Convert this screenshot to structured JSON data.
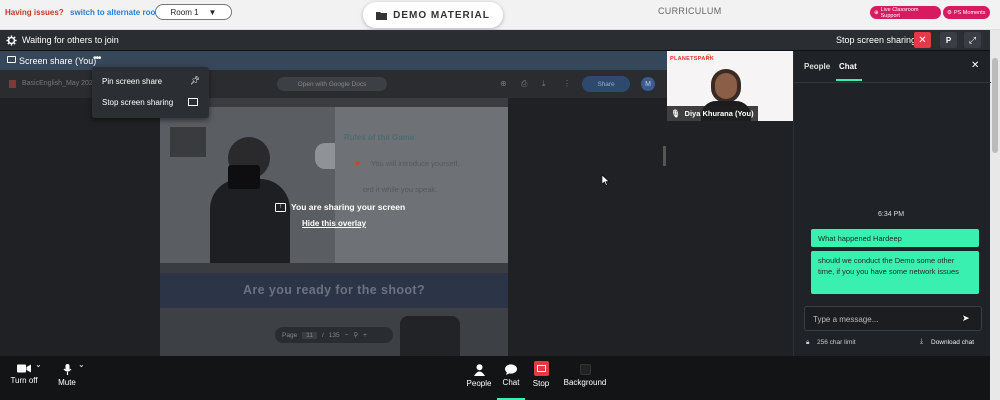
{
  "topbar": {
    "issues_text": "Having issues?",
    "switch_text": "switch to alternate room",
    "room_label": "Room 1",
    "demo_label": "DEMO MATERIAL",
    "curriculum_label": "CURRICULUM",
    "live_support": "Live Classroom Support",
    "ps_moments": "PS Moments"
  },
  "status": {
    "waiting_text": "Waiting for others to join",
    "stop_label": "Stop screen sharing",
    "p_badge": "P"
  },
  "share": {
    "tab_label": "Screen share (You)",
    "menu": [
      "Pin screen share",
      "Stop screen sharing"
    ],
    "doc_name": "BasicEnglish_May 202",
    "open_with": "Open with Google Docs",
    "share_btn": "Share",
    "avatar_letter": "M",
    "slide_title": "Rules of the Game",
    "rule1": "You will introduce yourself.",
    "rule2": "ord it while you speak.",
    "sharing_text": "You are sharing your screen",
    "hide_overlay": "Hide this overlay",
    "banner": "Are you ready for the shoot?",
    "page_label": "Page",
    "page_num": "11",
    "page_sep": "/",
    "page_total": "135"
  },
  "video": {
    "name": "Diya Khurana (You)",
    "logo": "PLANETSPARK"
  },
  "chat": {
    "tab_people": "People",
    "tab_chat": "Chat",
    "time": "6:34 PM",
    "messages": [
      "What happened Hardeep",
      "should we conduct the Demo some other time, if you you have some network issues"
    ],
    "placeholder": "Type a message...",
    "char_limit": "256 char limit",
    "download": "Download chat"
  },
  "controls": {
    "turn_off": "Turn off",
    "mute": "Mute",
    "people": "People",
    "chat": "Chat",
    "stop": "Stop",
    "background": "Background"
  },
  "colors": {
    "accent_green": "#3af0b0",
    "danger_red": "#e53945",
    "pink_pill": "#d81b60",
    "share_tab": "#37475a"
  }
}
